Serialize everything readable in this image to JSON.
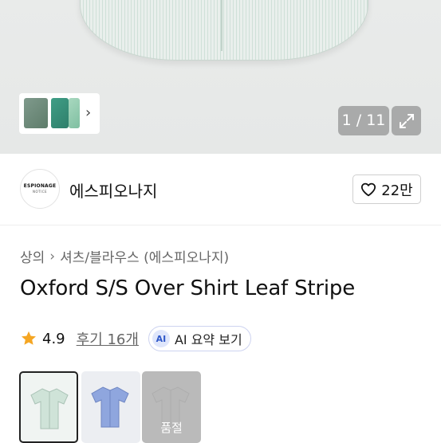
{
  "gallery": {
    "counter": "1 / 11",
    "expand_icon": "expand-icon",
    "next_icon": "chevron-right-icon"
  },
  "brand": {
    "logo_text_main": "ESPIONAGE",
    "logo_text_sub": "NOTICE",
    "name": "에스피오나지"
  },
  "like": {
    "icon": "heart-icon",
    "count": "22만"
  },
  "breadcrumb": {
    "items": [
      "상의",
      "셔츠/블라우스 (에스피오나지)"
    ],
    "separator_icon": "chevron-right-icon"
  },
  "product": {
    "title": "Oxford S/S Over Shirt Leaf Stripe"
  },
  "rating": {
    "score": "4.9",
    "reviews": "후기 16개",
    "star_color": "#f5a623"
  },
  "ai_summary": {
    "badge": "AI",
    "label": "AI 요약 보기",
    "accent": "#2f58c8"
  },
  "options": [
    {
      "color": "#cfe3d8",
      "selected": true,
      "sold_out": false
    },
    {
      "color": "#8fa6de",
      "selected": false,
      "sold_out": false
    },
    {
      "color": "#bfc0c2",
      "selected": false,
      "sold_out": true,
      "badge": "품절"
    }
  ]
}
